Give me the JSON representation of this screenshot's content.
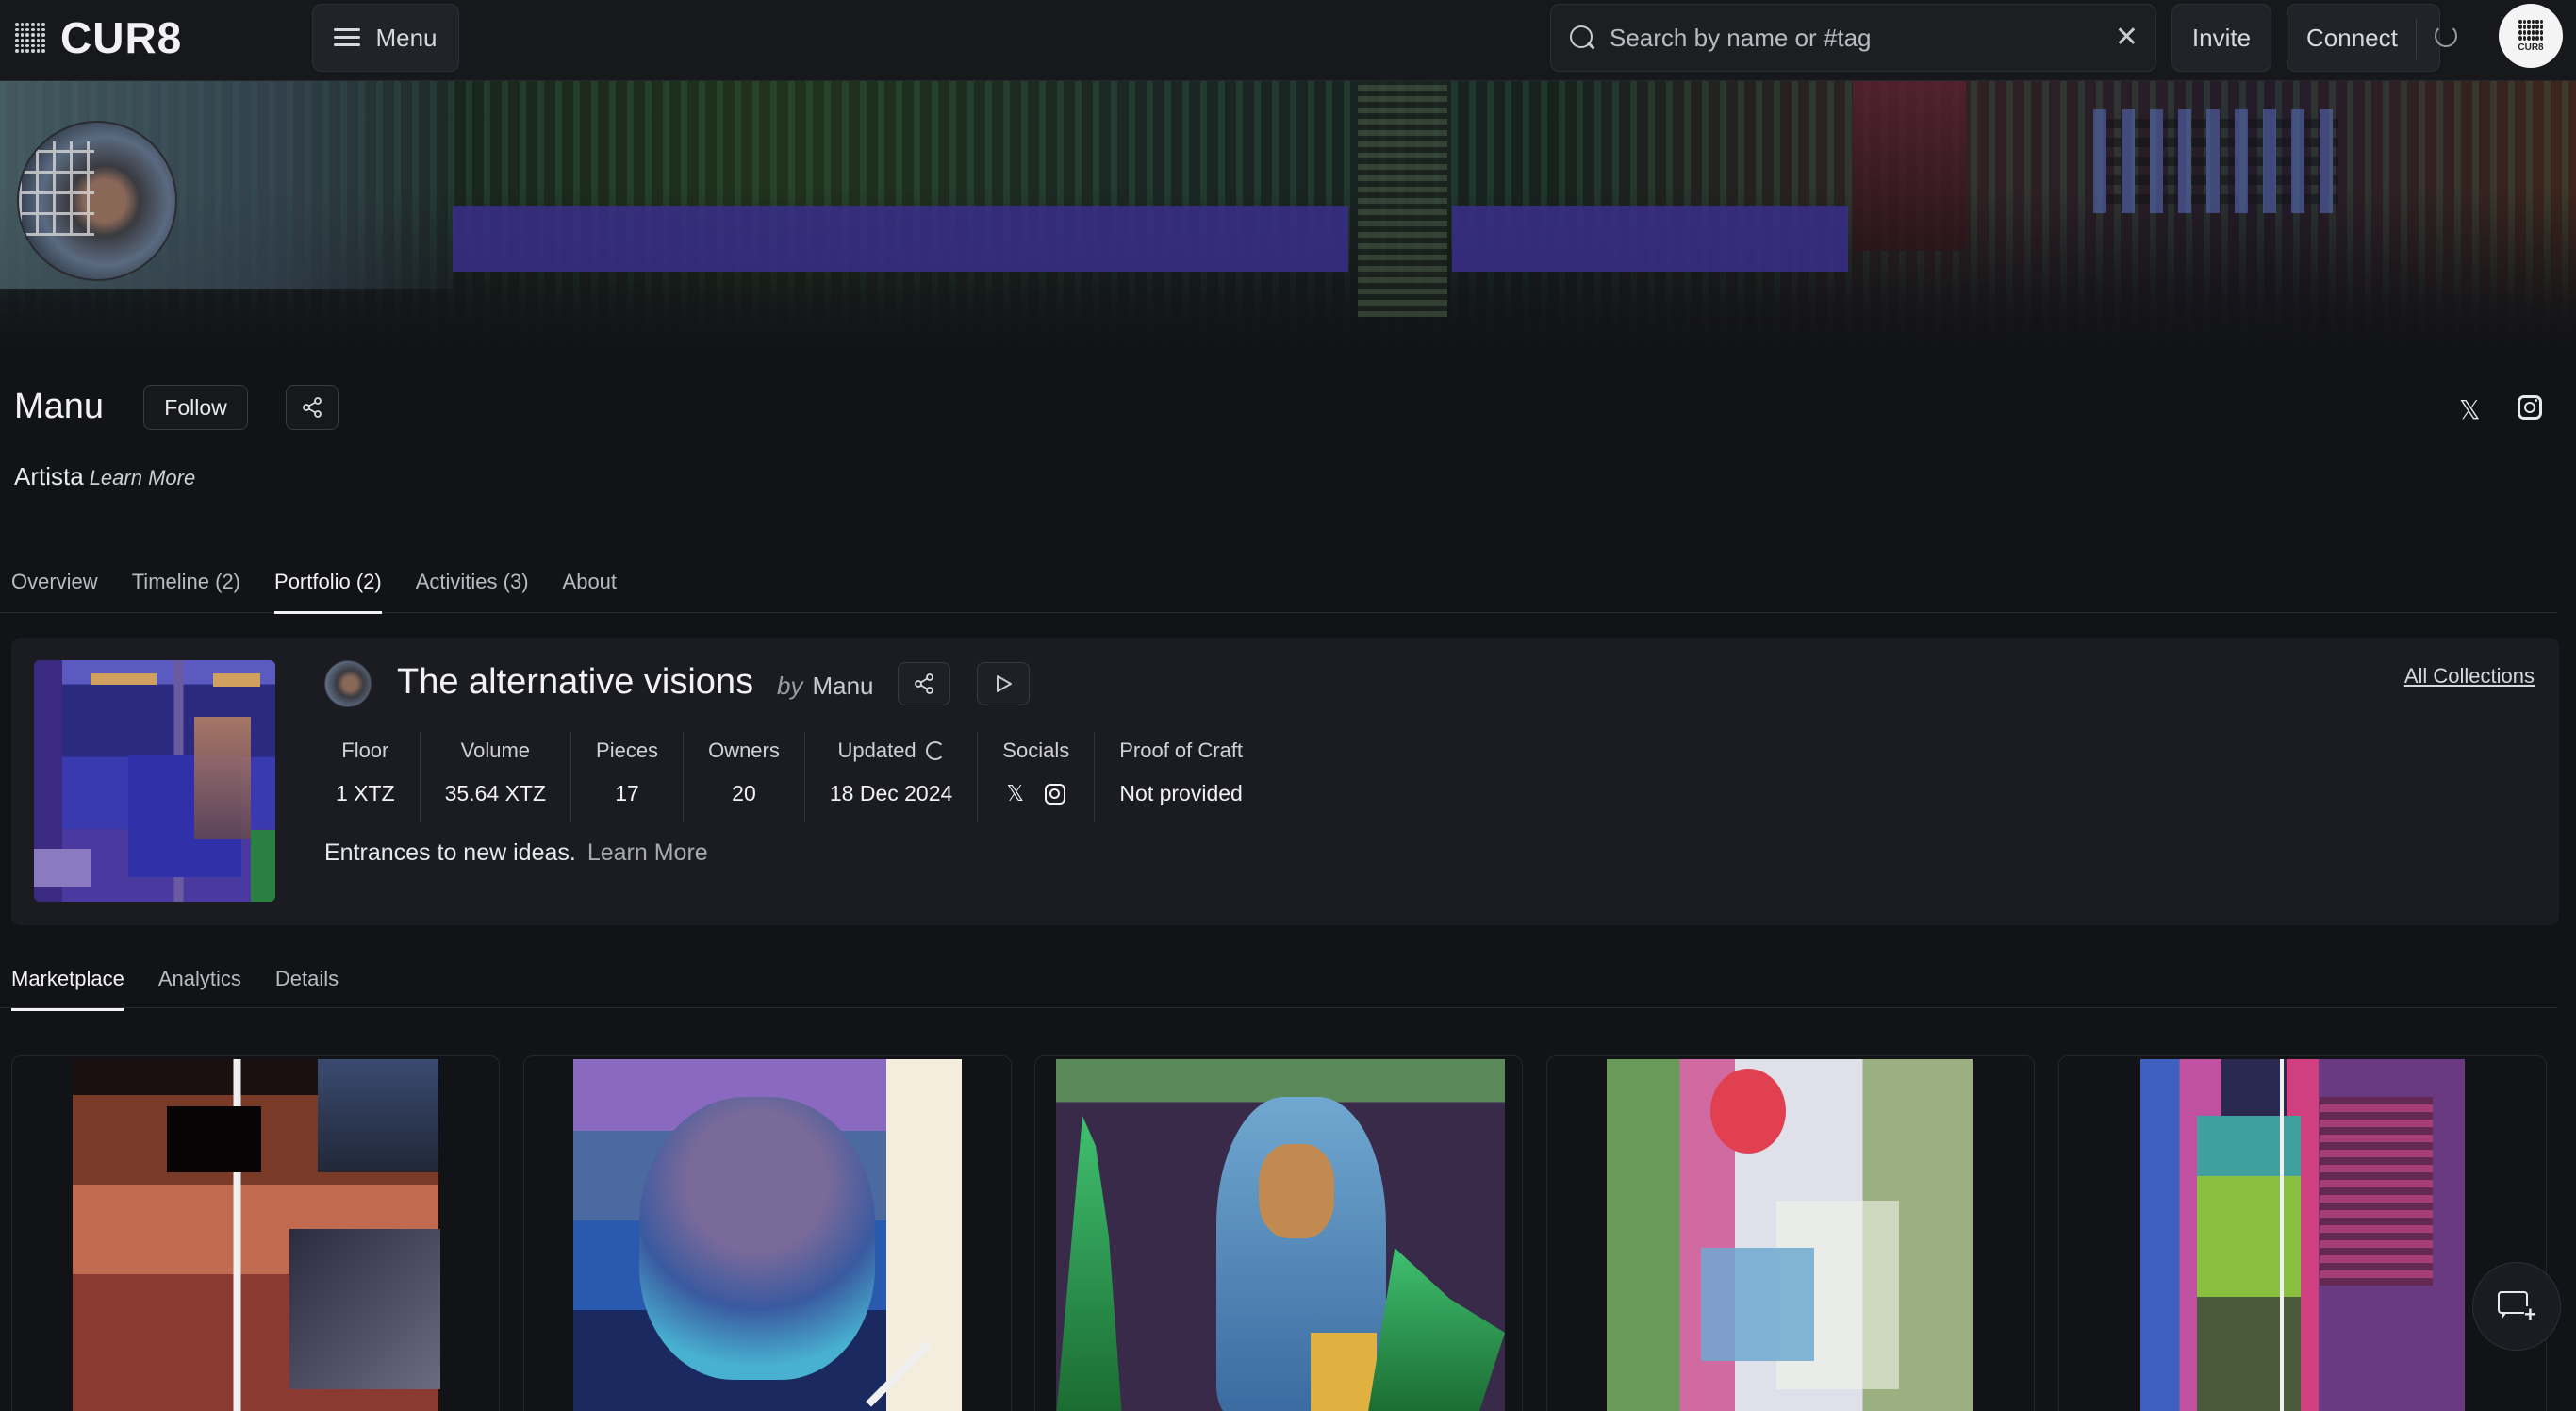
{
  "app": {
    "logo_text": "CUR8",
    "avatar_text": "CUR8"
  },
  "topbar": {
    "menu_label": "Menu",
    "search_placeholder": "Search by name or #tag",
    "invite_label": "Invite",
    "connect_label": "Connect"
  },
  "profile": {
    "name": "Manu",
    "follow_label": "Follow",
    "bio": "Artista",
    "bio_link": "Learn More"
  },
  "tabs": [
    {
      "label": "Overview"
    },
    {
      "label": "Timeline (2)"
    },
    {
      "label": "Portfolio (2)",
      "active": true
    },
    {
      "label": "Activities (3)"
    },
    {
      "label": "About"
    }
  ],
  "collection": {
    "title": "The alternative visions",
    "by_prefix": "by",
    "by_name": "Manu",
    "all_collections_label": "All Collections",
    "stats": {
      "floor_label": "Floor",
      "floor_value": "1 XTZ",
      "volume_label": "Volume",
      "volume_value": "35.64 XTZ",
      "pieces_label": "Pieces",
      "pieces_value": "17",
      "owners_label": "Owners",
      "owners_value": "20",
      "updated_label": "Updated",
      "updated_value": "18 Dec 2024",
      "socials_label": "Socials",
      "proof_label": "Proof of Craft",
      "proof_value": "Not provided"
    },
    "description": "Entrances to new ideas.",
    "description_link": "Learn More"
  },
  "subtabs": [
    {
      "label": "Marketplace",
      "active": true
    },
    {
      "label": "Analytics"
    },
    {
      "label": "Details"
    }
  ],
  "icons": {
    "x_glyph": "𝕏",
    "clear_glyph": "✕"
  },
  "colors": {
    "background": "#121317",
    "card": "#1b1c21",
    "text": "#e8e9ec",
    "muted": "#b9bbc1"
  }
}
